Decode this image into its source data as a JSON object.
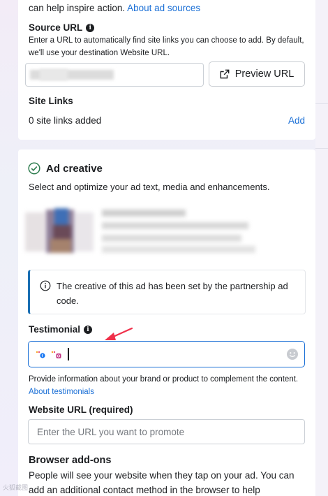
{
  "source_section": {
    "intro_text": "can help inspire action.",
    "about_link": "About ad sources",
    "source_url_label": "Source URL",
    "source_url_help": "Enter a URL to automatically find site links you can choose to add. By default, we'll use your destination Website URL.",
    "preview_button": "Preview URL",
    "site_links_label": "Site Links",
    "site_links_count": "0 site links added",
    "add_link": "Add"
  },
  "ad_creative": {
    "title": "Ad creative",
    "subtitle": "Select and optimize your ad text, media and enhancements.",
    "notice": "The creative of this ad has been set by the partnership ad code.",
    "testimonial_label": "Testimonial",
    "testimonial_help": "Provide information about your brand or product to complement the content.",
    "about_testimonials": "About testimonials",
    "website_label": "Website URL (required)",
    "website_placeholder": "Enter the URL you want to promote",
    "browser_label": "Browser add-ons",
    "browser_help": "People will see your website when they tap on your ad. You can add an additional contact method in the browser to help"
  },
  "watermark": "火狐截图",
  "colors": {
    "accent": "#1a6fd6",
    "notice_bar": "#1a6fb3",
    "success": "#2e7d4f",
    "annotation_arrow": "#f0304a"
  }
}
